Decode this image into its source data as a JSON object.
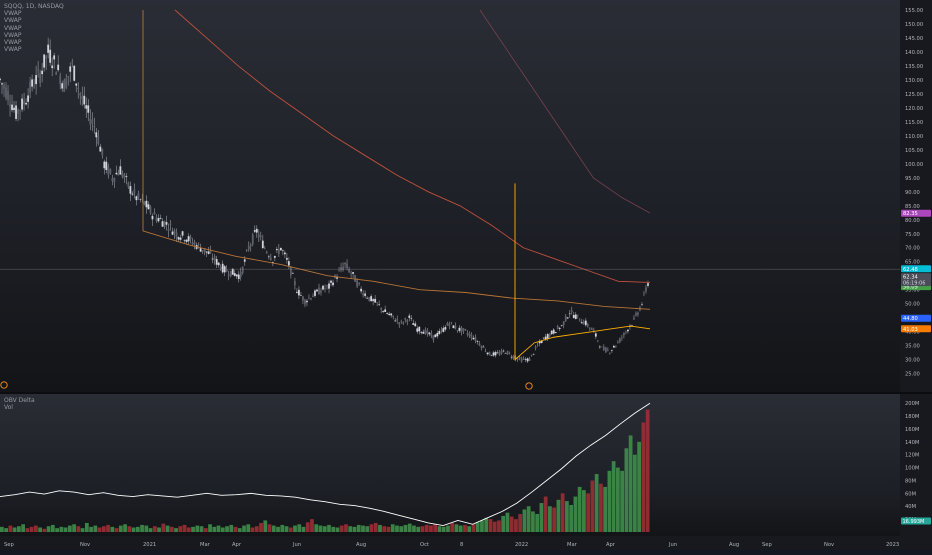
{
  "header": {
    "symbol_line": "SQQQ, 1D, NASDAQ",
    "indicators": [
      "VWAP",
      "VWAP",
      "VWAP",
      "VWAP",
      "VWAP",
      "VWAP"
    ]
  },
  "oscillator": {
    "title": "OBV Delta",
    "subtitle": "Vol"
  },
  "chart_data": [
    {
      "type": "candlestick",
      "title": "SQQQ, 1D, NASDAQ",
      "ylim": [
        22,
        155
      ],
      "y_ticks": [
        "155.00",
        "150.00",
        "145.00",
        "140.00",
        "135.00",
        "130.00",
        "125.00",
        "120.00",
        "115.00",
        "110.00",
        "105.00",
        "100.00",
        "95.00",
        "90.00",
        "85.00",
        "80.00",
        "75.00",
        "70.00",
        "65.00",
        "60.00",
        "55.00",
        "50.00",
        "45.00",
        "40.00",
        "35.00",
        "30.00",
        "25.00"
      ],
      "x_ticks": [
        "Sep",
        "Nov",
        "2021",
        "Mar",
        "Apr",
        "Jun",
        "Aug",
        "Oct",
        "8",
        "2022",
        "Mar",
        "Apr",
        "Jun",
        "Aug",
        "Sep",
        "Nov",
        "2023"
      ],
      "close_path": [
        [
          0,
          130
        ],
        [
          2,
          125
        ],
        [
          4,
          118
        ],
        [
          6,
          122
        ],
        [
          8,
          128
        ],
        [
          10,
          132
        ],
        [
          12,
          140
        ],
        [
          14,
          135
        ],
        [
          16,
          128
        ],
        [
          18,
          135
        ],
        [
          20,
          125
        ],
        [
          22,
          118
        ],
        [
          24,
          112
        ],
        [
          26,
          100
        ],
        [
          28,
          95
        ],
        [
          30,
          98
        ],
        [
          32,
          92
        ],
        [
          34,
          88
        ],
        [
          36,
          86
        ],
        [
          38,
          82
        ],
        [
          40,
          80
        ],
        [
          42,
          78
        ],
        [
          44,
          75
        ],
        [
          46,
          74
        ],
        [
          48,
          72
        ],
        [
          50,
          70
        ],
        [
          52,
          68
        ],
        [
          54,
          65
        ],
        [
          56,
          62
        ],
        [
          58,
          61
        ],
        [
          60,
          60
        ],
        [
          62,
          70
        ],
        [
          64,
          76
        ],
        [
          66,
          70
        ],
        [
          68,
          66
        ],
        [
          70,
          70
        ],
        [
          72,
          64
        ],
        [
          74,
          55
        ],
        [
          76,
          51
        ],
        [
          78,
          53
        ],
        [
          80,
          55
        ],
        [
          82,
          56
        ],
        [
          84,
          60
        ],
        [
          86,
          64
        ],
        [
          88,
          60
        ],
        [
          90,
          55
        ],
        [
          92,
          52
        ],
        [
          94,
          50
        ],
        [
          96,
          47
        ],
        [
          98,
          45
        ],
        [
          100,
          43
        ],
        [
          102,
          45
        ],
        [
          104,
          41
        ],
        [
          106,
          40
        ],
        [
          108,
          38
        ],
        [
          110,
          40
        ],
        [
          112,
          43
        ],
        [
          114,
          41
        ],
        [
          116,
          40
        ],
        [
          118,
          38
        ],
        [
          120,
          35
        ],
        [
          122,
          32
        ],
        [
          124,
          32
        ],
        [
          126,
          33
        ],
        [
          128,
          31
        ],
        [
          130,
          30
        ],
        [
          132,
          30
        ],
        [
          134,
          35
        ],
        [
          136,
          38
        ],
        [
          138,
          40
        ],
        [
          140,
          42
        ],
        [
          142,
          47
        ],
        [
          144,
          45
        ],
        [
          146,
          43
        ],
        [
          148,
          40
        ],
        [
          150,
          34
        ],
        [
          152,
          33
        ],
        [
          154,
          36
        ],
        [
          156,
          40
        ],
        [
          158,
          44
        ],
        [
          160,
          50
        ],
        [
          162,
          60
        ]
      ],
      "last_price": "62.34",
      "countdown": "06:19:06",
      "price_labels": [
        {
          "value": "62.48",
          "color": "#00bcd4"
        },
        {
          "value": "82.35",
          "color": "#ab47bc"
        },
        {
          "value": "57.62",
          "color": "#ef5350"
        },
        {
          "value": "56.09",
          "color": "#43a047"
        },
        {
          "value": "44.80",
          "color": "#2962ff"
        },
        {
          "value": "41.03",
          "color": "#f57c00"
        }
      ],
      "series": [
        {
          "name": "VWAP",
          "color": "#b87333",
          "anchor_date": "Jan 2021",
          "y": [
            155,
            76,
            71,
            67,
            64,
            60,
            58,
            55,
            54,
            52,
            51,
            49,
            48
          ]
        },
        {
          "name": "VWAP",
          "color": "#c0503c",
          "y": [
            155,
            145,
            135,
            126,
            118,
            110,
            103,
            96,
            90,
            85,
            78,
            70,
            66,
            62,
            58,
            57.6
          ]
        },
        {
          "name": "VWAP",
          "color": "#ffb000",
          "anchor_date": "Jan 2022",
          "y": [
            30,
            36,
            38,
            39,
            40,
            41,
            42,
            41
          ]
        },
        {
          "name": "VWAP",
          "color": "#8a4a5a",
          "y": [
            155,
            140,
            125,
            110,
            95,
            88,
            82.4
          ]
        }
      ]
    },
    {
      "type": "bar",
      "title": "OBV Delta",
      "ylim": [
        0,
        205
      ],
      "y_ticks": [
        "200M",
        "180M",
        "160M",
        "140M",
        "120M",
        "100M",
        "80M",
        "60M",
        "40M",
        "20M"
      ],
      "last_value": "16.993M",
      "obv_line": [
        [
          0,
          55
        ],
        [
          5,
          58
        ],
        [
          10,
          62
        ],
        [
          15,
          59
        ],
        [
          20,
          64
        ],
        [
          25,
          62
        ],
        [
          30,
          58
        ],
        [
          35,
          61
        ],
        [
          40,
          57
        ],
        [
          45,
          55
        ],
        [
          50,
          58
        ],
        [
          55,
          56
        ],
        [
          60,
          54
        ],
        [
          65,
          57
        ],
        [
          70,
          60
        ],
        [
          75,
          57
        ],
        [
          80,
          58
        ],
        [
          85,
          60
        ],
        [
          90,
          57
        ],
        [
          95,
          56
        ],
        [
          100,
          54
        ],
        [
          105,
          50
        ],
        [
          110,
          47
        ],
        [
          115,
          43
        ],
        [
          120,
          41
        ],
        [
          125,
          37
        ],
        [
          130,
          32
        ],
        [
          135,
          26
        ],
        [
          140,
          20
        ],
        [
          145,
          14
        ],
        [
          150,
          10
        ],
        [
          155,
          18
        ],
        [
          160,
          12
        ],
        [
          165,
          22
        ],
        [
          170,
          32
        ],
        [
          175,
          45
        ],
        [
          180,
          62
        ],
        [
          185,
          80
        ],
        [
          190,
          98
        ],
        [
          195,
          118
        ],
        [
          200,
          135
        ],
        [
          205,
          150
        ],
        [
          210,
          168
        ],
        [
          215,
          185
        ],
        [
          220,
          200
        ]
      ],
      "volume_bars": [
        8,
        6,
        10,
        7,
        9,
        12,
        6,
        8,
        10,
        7,
        5,
        9,
        11,
        6,
        8,
        7,
        10,
        12,
        9,
        6,
        14,
        8,
        10,
        7,
        9,
        11,
        8,
        6,
        10,
        12,
        9,
        7,
        8,
        11,
        10,
        6,
        9,
        7,
        13,
        10,
        8,
        6,
        9,
        11,
        7,
        8,
        10,
        9,
        6,
        12,
        8,
        10,
        7,
        9,
        11,
        8,
        6,
        10,
        12,
        7,
        9,
        14,
        18,
        12,
        10,
        8,
        11,
        9,
        7,
        10,
        12,
        8,
        15,
        20,
        12,
        10,
        9,
        11,
        8,
        7,
        10,
        12,
        9,
        8,
        11,
        10,
        9,
        12,
        14,
        11,
        9,
        8,
        12,
        10,
        9,
        11,
        13,
        10,
        8,
        9,
        11,
        10,
        12,
        9,
        8,
        10,
        14,
        12,
        10,
        11,
        9,
        12,
        15,
        18,
        22,
        20,
        16,
        18,
        25,
        30,
        24,
        20,
        28,
        35,
        40,
        32,
        28,
        45,
        55,
        40,
        38,
        50,
        60,
        48,
        42,
        55,
        70,
        65,
        60,
        80,
        90,
        75,
        70,
        95,
        110,
        100,
        95,
        130,
        150,
        120,
        140,
        170,
        190
      ]
    }
  ]
}
